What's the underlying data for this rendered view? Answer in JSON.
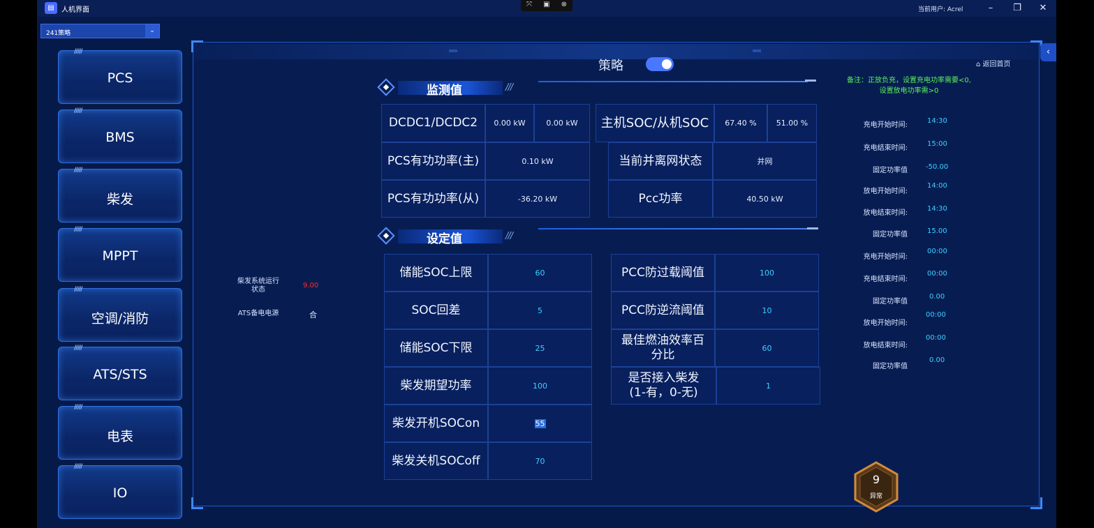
{
  "window": {
    "title": "人机界面",
    "app_icon": "app-window-icon",
    "capture_bar": [
      "⤧",
      "▣",
      "⊗"
    ],
    "current_user": "当前用户: Acrel",
    "controls": {
      "minimize": "–",
      "restore": "❐",
      "close": "✕"
    }
  },
  "strategy_select": {
    "value": "241策略",
    "arrow": "⌄"
  },
  "sidebar": {
    "items": [
      {
        "label": "PCS"
      },
      {
        "label": "BMS"
      },
      {
        "label": "柴发"
      },
      {
        "label": "MPPT"
      },
      {
        "label": "空调/消防"
      },
      {
        "label": "ATS/STS"
      },
      {
        "label": "电表"
      },
      {
        "label": "IO"
      }
    ],
    "tick": "/////"
  },
  "header": {
    "strategy_title": "策略",
    "toggle_on": true,
    "back_home": "返回首页",
    "chevron_left": "›››››",
    "chevron_right": "‹‹‹‹‹",
    "collapse": "‹"
  },
  "note": {
    "line1": "备注：正放负充，设置充电功率需要<0,",
    "line2": "设置放电功率需>0"
  },
  "monitor": {
    "title": "监测值",
    "hatch": "///",
    "rows": [
      {
        "label": "DCDC1/DCDC2",
        "v1": "0.00 kW",
        "v2": "0.00 kW",
        "label2": "主机SOC/从机SOC",
        "v3": "67.40 %",
        "v4": "51.00 %"
      },
      {
        "label": "PCS有功功率(主)",
        "v1": "0.10 kW",
        "label2": "当前并离网状态",
        "v3": "并网"
      },
      {
        "label": "PCS有功功率(从)",
        "v1": "-36.20 kW",
        "label2": "Pcc功率",
        "v3": "40.50 kW"
      }
    ]
  },
  "settings": {
    "title": "设定值",
    "hatch": "///",
    "left": [
      {
        "label": "储能SOC上限",
        "value": "60"
      },
      {
        "label": "SOC回差",
        "value": "5"
      },
      {
        "label": "储能SOC下限",
        "value": "25"
      },
      {
        "label": "柴发期望功率",
        "value": "100"
      },
      {
        "label": "柴发开机SOCon",
        "value": "55"
      },
      {
        "label": "柴发关机SOCoff",
        "value": "70"
      }
    ],
    "right": [
      {
        "label": "PCC防过载阈值",
        "value": "100"
      },
      {
        "label": "PCC防逆流阈值",
        "value": "10"
      },
      {
        "label_l1": "最佳燃油效率百",
        "label_l2": "分比",
        "value": "60"
      },
      {
        "label_l1": "是否接入柴发",
        "label_l2": "(1-有，0-无)",
        "value": "1"
      }
    ]
  },
  "diesel_status": {
    "run_label_l1": "柴发系统运行",
    "run_label_l2": "状态",
    "run_value": "9.00",
    "run_value_color": "#ff2a2a",
    "ats_label": "ATS备电电源",
    "ats_value": "合"
  },
  "schedule": [
    {
      "label": "充电开始时间:",
      "value": "14:30"
    },
    {
      "label": "充电结束时间:",
      "value": "15:00"
    },
    {
      "label": "固定功率值",
      "value": "-50.00"
    },
    {
      "label": "放电开始时间:",
      "value": "14:00"
    },
    {
      "label": "放电结束时间:",
      "value": "14:30"
    },
    {
      "label": "固定功率值",
      "value": "15.00"
    },
    {
      "label": "充电开始时间:",
      "value": "00:00"
    },
    {
      "label": "充电结束时间:",
      "value": "00:00"
    },
    {
      "label": "固定功率值",
      "value": "0.00"
    },
    {
      "label": "放电开始时间:",
      "value": "00:00"
    },
    {
      "label": "放电结束时间:",
      "value": "00:00"
    },
    {
      "label": "固定功率值",
      "value": "0.00"
    }
  ],
  "alarm": {
    "count": "9",
    "label": "异常",
    "color": "#c7802f"
  },
  "colors": {
    "accent": "#4a77ff",
    "value_cyan": "#3fd0ff",
    "note_green": "#5af05a"
  }
}
